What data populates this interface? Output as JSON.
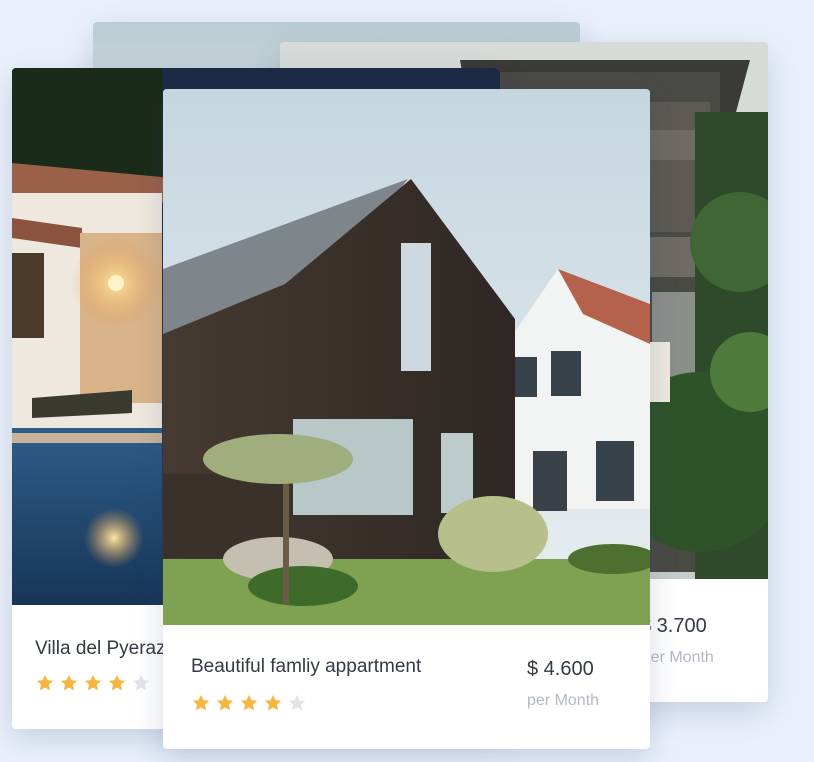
{
  "listings": [
    {
      "title": "",
      "price": "",
      "period": "",
      "rating": 0
    },
    {
      "title": "",
      "price": "$ 3.700",
      "period": "Per Month",
      "rating": 0
    },
    {
      "title": "Villa del Pyeraz",
      "price": "",
      "period": "",
      "rating": 4
    },
    {
      "title": "Beautiful famliy appartment",
      "price": "$ 4.600",
      "period": "per Month",
      "rating": 4
    }
  ],
  "colors": {
    "page_background": "#eaf0fb",
    "star_filled": "#f6b641",
    "star_empty": "#e3e4e8",
    "title_text": "#333a44",
    "muted_text": "#b3b8c2"
  },
  "icons": {
    "rating_star": "star-icon"
  }
}
